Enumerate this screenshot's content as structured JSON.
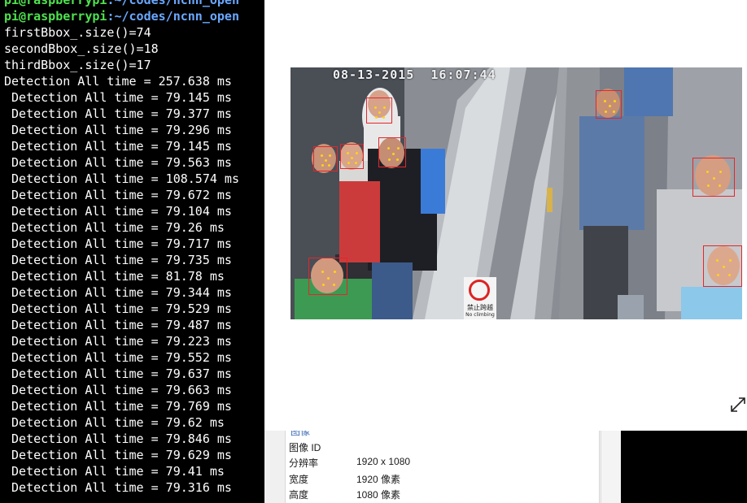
{
  "terminal": {
    "prompt_top": {
      "user": "pi@raspberrypi",
      "path": ":~/codes/ncnn_open"
    },
    "prompt": {
      "user": "pi@raspberrypi",
      "path": ":~/codes/ncnn_open"
    },
    "lines": [
      "firstBbox_.size()=74",
      "secondBbox_.size()=18",
      "thirdBbox_.size()=17",
      "Detection All time = 257.638 ms",
      " Detection All time = 79.145 ms",
      " Detection All time = 79.377 ms",
      " Detection All time = 79.296 ms",
      " Detection All time = 79.145 ms",
      " Detection All time = 79.563 ms",
      " Detection All time = 108.574 ms",
      " Detection All time = 79.672 ms",
      " Detection All time = 79.104 ms",
      " Detection All time = 79.26 ms",
      " Detection All time = 79.717 ms",
      " Detection All time = 79.735 ms",
      " Detection All time = 81.78 ms",
      " Detection All time = 79.344 ms",
      " Detection All time = 79.529 ms",
      " Detection All time = 79.487 ms",
      " Detection All time = 79.223 ms",
      " Detection All time = 79.552 ms",
      " Detection All time = 79.637 ms",
      " Detection All time = 79.663 ms",
      " Detection All time = 79.769 ms",
      " Detection All time = 79.62 ms",
      " Detection All time = 79.846 ms",
      " Detection All time = 79.629 ms",
      " Detection All time = 79.41 ms",
      " Detection All time = 79.316 ms"
    ],
    "colors": {
      "user": "#4ee24e",
      "path": "#6aa8ff",
      "text": "#ffffff",
      "bg": "#000000"
    }
  },
  "viewer": {
    "timestamp": "08-13-2015  16:07:44",
    "sign_text_cn": "禁止跨越",
    "sign_text_en": "No climbing",
    "expand_icon": "expand-diagonal-icon",
    "face_box_color": "#e4262a",
    "landmark_color": "#ffd21a"
  },
  "properties": {
    "section": "图像",
    "rows": [
      {
        "label": "图像 ID",
        "value": ""
      },
      {
        "label": "分辨率",
        "value": "1920 x 1080"
      },
      {
        "label": "宽度",
        "value": "1920 像素"
      },
      {
        "label": "高度",
        "value": "1080 像素"
      }
    ]
  }
}
